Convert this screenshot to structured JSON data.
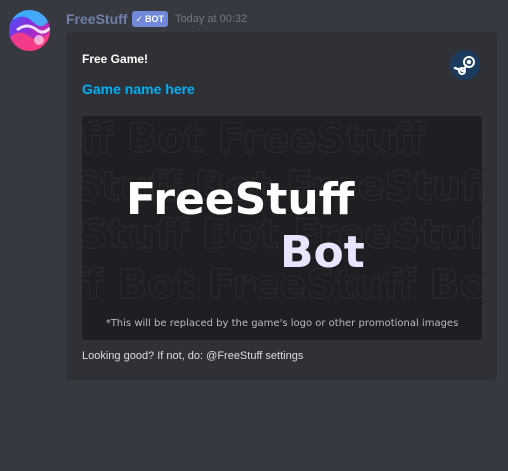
{
  "message": {
    "author": "FreeStuff",
    "bot_tag": "BOT",
    "timestamp": "Today at 00:32"
  },
  "embed": {
    "title": "Free Game!",
    "link_text": "Game name here",
    "image": {
      "headline_top": "FreeStuff",
      "headline_bottom": "Bot",
      "caption": "*This will be replaced by the game's logo or other promotional images"
    },
    "footer": "Looking good? If not, do: @FreeStuff settings",
    "thumbnail_icon": "steam-icon"
  },
  "colors": {
    "background": "#36393f",
    "embed_bg": "#2f3136",
    "bot_tag": "#7289da",
    "link": "#00b0f4",
    "username": "#6e7fa8"
  }
}
